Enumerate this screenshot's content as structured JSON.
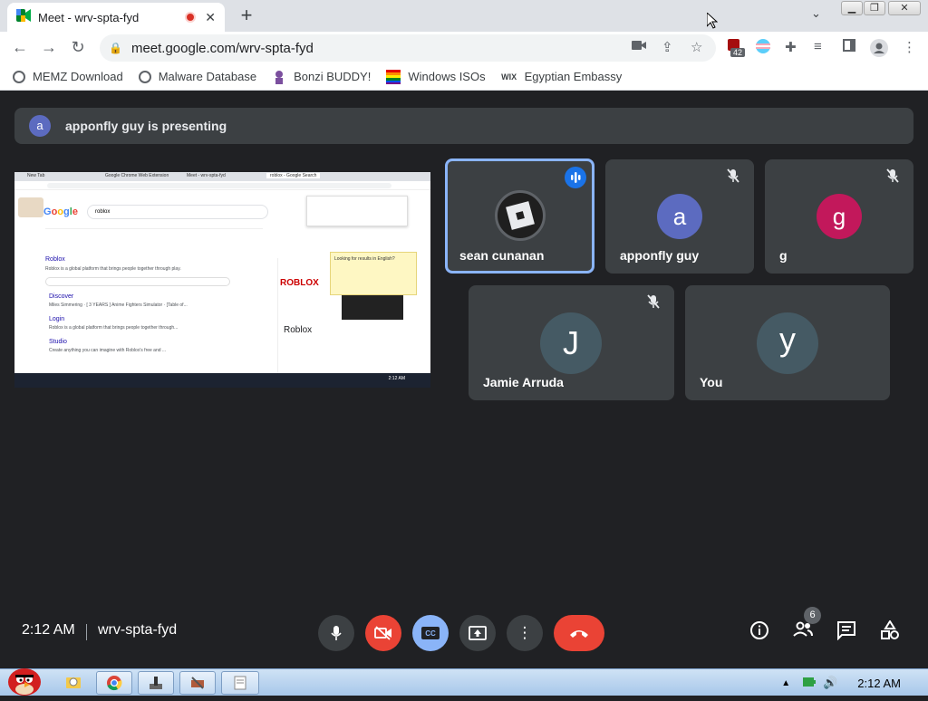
{
  "browser": {
    "tab_title": "Meet - wrv-spta-fyd",
    "close_glyph": "✕",
    "new_tab_glyph": "+",
    "tab_menu_glyph": "⌄",
    "url": "meet.google.com/wrv-spta-fyd",
    "extension_badge": "42",
    "window_controls": {
      "minimize": "▁",
      "maximize": "❐",
      "close": "✕"
    }
  },
  "bookmarks": [
    {
      "label": "MEMZ Download",
      "icon": "globe-icon"
    },
    {
      "label": "Malware Database",
      "icon": "globe-icon"
    },
    {
      "label": "Bonzi BUDDY!",
      "icon": "bonzi-icon"
    },
    {
      "label": "Windows ISOs",
      "icon": "rainbow-flag-icon"
    },
    {
      "label": "Egyptian Embassy",
      "icon": "wix-icon",
      "icon_text": "WIX"
    }
  ],
  "meet": {
    "presenting_banner": {
      "avatar_letter": "a",
      "text": "apponfly guy is presenting"
    },
    "participants": [
      {
        "name": "sean cunanan",
        "avatar": "",
        "avatar_color": "#3c4043",
        "speaking": true,
        "muted": false
      },
      {
        "name": "apponfly guy",
        "avatar": "a",
        "avatar_color": "#5c6bc0",
        "muted": true
      },
      {
        "name": "g",
        "avatar": "g",
        "avatar_color": "#c2185b",
        "muted": true
      },
      {
        "name": "Jamie Arruda",
        "avatar": "J",
        "avatar_color": "#455a64",
        "muted": true
      },
      {
        "name": "You",
        "avatar": "y",
        "avatar_color": "#455a64",
        "muted": false
      }
    ],
    "bottom_bar": {
      "time": "2:12 AM",
      "meeting_code": "wrv-spta-fyd",
      "people_count": "6"
    }
  },
  "shared_screen": {
    "search_query": "roblox",
    "tabs": [
      "New Tab",
      "Google Chrome Web Extension",
      "Meet - wrv-spta-fyd",
      "roblox - Google Search"
    ],
    "results": [
      {
        "title": "Roblox",
        "snippet": "Roblox is a global platform that brings people together through play."
      },
      {
        "title": "Discover",
        "snippet": "Miles Simmering · [ 3 YEARS ] Anime Fighters Simulator · [Table of..."
      },
      {
        "title": "Login",
        "snippet": "Roblox is a global platform that brings people together through..."
      },
      {
        "title": "Studio",
        "snippet": "Create anything you can imagine with Roblox's free and ..."
      }
    ],
    "knowledge_panel_title": "Roblox",
    "knowledge_panel_logo": "ROBLOX",
    "translate_popup": "Looking for results in English?",
    "taskbar_time": "2:12 AM"
  },
  "taskbar": {
    "time": "2:12 AM"
  },
  "colors": {
    "meet_bg": "#202124",
    "tile_bg": "#3c4043",
    "hangup_red": "#ea4335",
    "cc_blue": "#8ab4f8",
    "speaking_border": "#8ab4f8"
  }
}
